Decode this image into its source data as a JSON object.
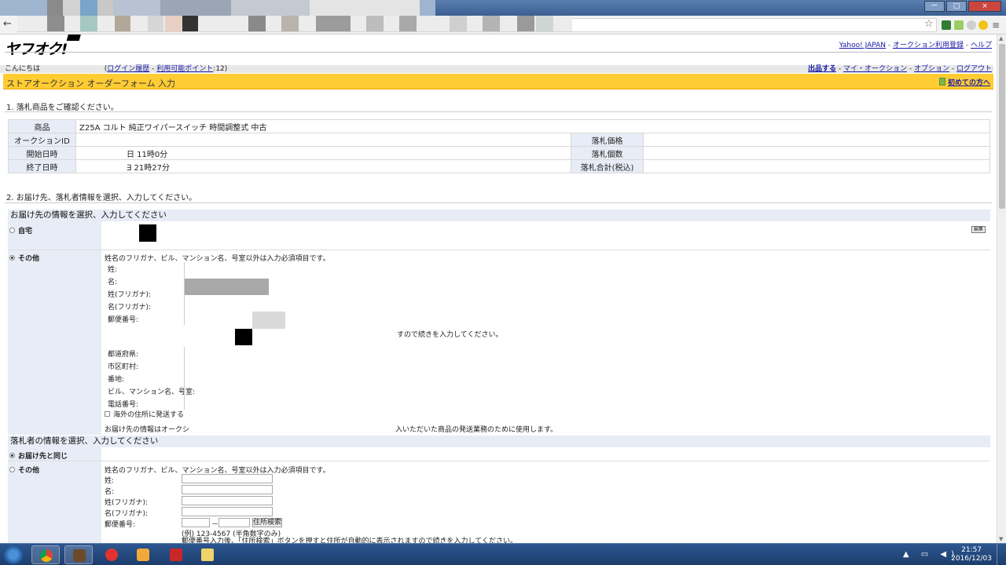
{
  "browser": {
    "back": "←",
    "star": "☆",
    "menu": "≡",
    "window_buttons": [
      "ー",
      "□",
      "×"
    ]
  },
  "header": {
    "logo": "ヤフオク!",
    "links": [
      "Yahoo! JAPAN",
      "オークション利用登録",
      "ヘルプ"
    ]
  },
  "greeting": {
    "prefix": "こんにちは",
    "login_history": "ログイン履歴",
    "points": "利用可能ポイント",
    "points_value": "12",
    "right_links": [
      "出品する",
      "マイ・オークション",
      "オプション",
      "ログアウト"
    ]
  },
  "page_title": "ストアオークション オーダーフォーム 入力",
  "first_time_link": "初めての方へ",
  "section1": {
    "heading": "1. 落札商品をご確認ください。",
    "rows": [
      {
        "label": "商品",
        "value": "Z25A コルト 純正ワイパースイッチ 時間調整式 中古"
      },
      {
        "label": "オークションID",
        "value": "",
        "label2": "落札価格",
        "value2": ""
      },
      {
        "label": "開始日時",
        "value": "日 11時0分",
        "label2": "落札個数",
        "value2": ""
      },
      {
        "label": "終了日時",
        "value": "∃ 21時27分",
        "label2": "落札合計(税込)",
        "value2": ""
      }
    ]
  },
  "section2": {
    "heading": "2. お届け先、落札者情報を選択、入力してください。",
    "delivery_head": "お届け先の情報を選択、入力してください",
    "home_label": "自宅",
    "edit_button": "編集",
    "other_label": "その他",
    "other_note": "姓名のフリガナ、ビル、マンション名、号室以外は入力必須項目です。",
    "fields": [
      "姓:",
      "名:",
      "姓(フリガナ):",
      "名(フリガナ):",
      "郵便番号:"
    ],
    "postal_note": "すので続きを入力してください。",
    "fields2": [
      "都道府県:",
      "市区町村:",
      "番地:",
      "ビル、マンション名、号室:",
      "電話番号:"
    ],
    "overseas": "海外の住所に発送する",
    "privacy_note_a": "お届け先の情報はオークシ",
    "privacy_note_b": "入いただいた商品の発送業務のために使用します。",
    "bidder_head": "落札者の情報を選択、入力してください",
    "same_label": "お届け先と同じ",
    "other_label2": "その他",
    "bidder_note": "姓名のフリガナ、ビル、マンション名、号室以外は入力必須項目です。",
    "bidder_fields": [
      "姓:",
      "名:",
      "姓(フリガナ):",
      "名(フリガナ):",
      "郵便番号:"
    ],
    "zip_dash": "－",
    "address_search": "住所検索",
    "zip_example": "(例) 123-4567 (半角数字のみ)",
    "zip_instruction": "郵便番号入力後、「住所検索」ボタンを押すと住所が自動的に表示されますので続きを入力してください。"
  },
  "taskbar": {
    "time": "21:57",
    "date": "2016/12/03"
  }
}
